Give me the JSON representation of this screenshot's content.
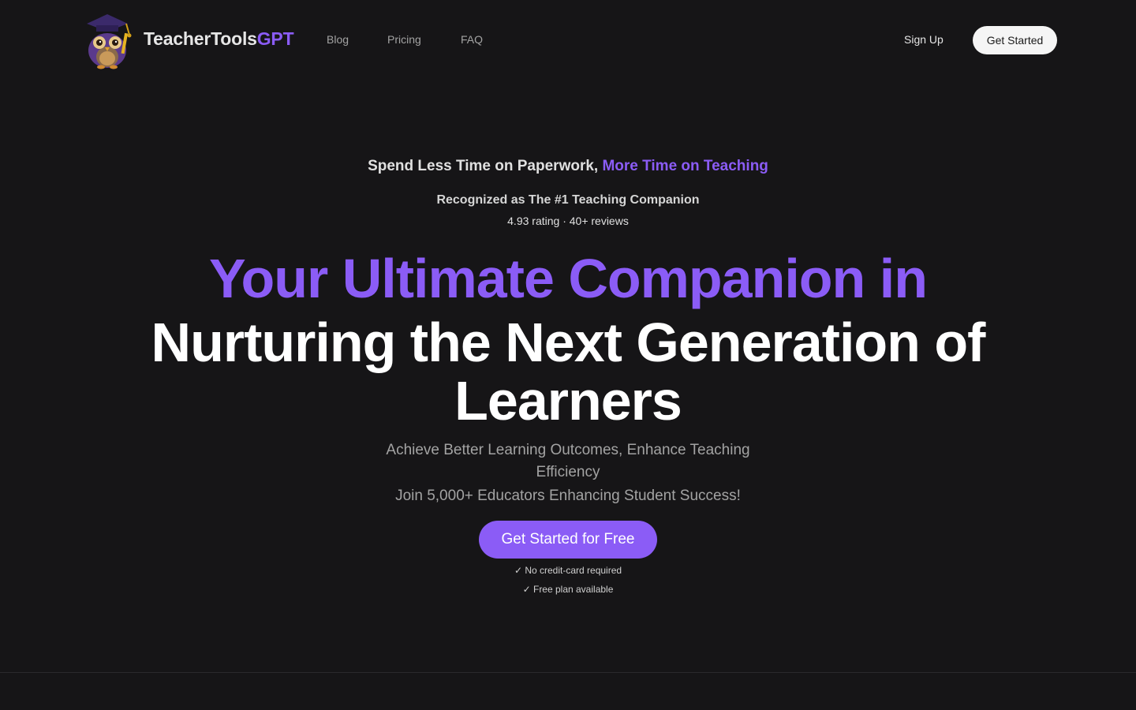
{
  "nav": {
    "brand_part1": "TeacherTools",
    "brand_part2": "GPT",
    "links": [
      {
        "label": "Blog"
      },
      {
        "label": "Pricing"
      },
      {
        "label": "FAQ"
      }
    ],
    "sign_up": "Sign Up",
    "get_started": "Get Started"
  },
  "hero": {
    "tagline_main": "Spend Less Time on Paperwork, ",
    "tagline_accent": "More Time on Teaching",
    "recognized": "Recognized as The #1 Teaching Companion",
    "rating": "4.93 rating · 40+ reviews",
    "headline_line1": "Your Ultimate Companion in",
    "headline_line2": "Nurturing the Next Generation of",
    "headline_line3": "Learners",
    "subtitle": "Achieve Better Learning Outcomes, Enhance Teaching Efficiency",
    "join": "Join 5,000+ Educators Enhancing Student Success!",
    "cta": "Get Started for Free",
    "note1": "✓ No credit-card required",
    "note2": "✓ Free plan available"
  },
  "colors": {
    "background": "#161517",
    "accent": "#8b5cf6",
    "button_light": "#f5f5f5"
  },
  "icons": {
    "logo": "owl-graduate-mascot-icon"
  }
}
